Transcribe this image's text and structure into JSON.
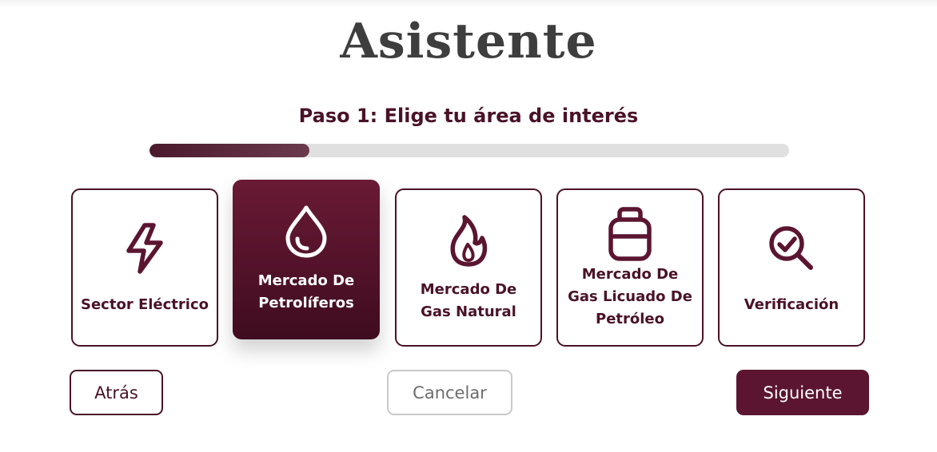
{
  "wizard": {
    "title": "Asistente",
    "step_label": "Paso 1: Elige tu área de interés",
    "progress": 0.25
  },
  "options": [
    {
      "label": "Sector Eléctrico",
      "icon": "lightning-bolt-icon",
      "selected": false
    },
    {
      "label": "Mercado De Petrolíferos",
      "icon": "oil-drop-icon",
      "selected": true
    },
    {
      "label": "Mercado De Gas Natural",
      "icon": "flame-icon",
      "selected": false
    },
    {
      "label": "Mercado De Gas Licuado De Petróleo",
      "icon": "gas-cylinder-icon",
      "selected": false
    },
    {
      "label": "Verificación",
      "icon": "magnifier-check-icon",
      "selected": false
    }
  ],
  "buttons": {
    "back": "Atrás",
    "cancel": "Cancelar",
    "next": "Siguiente"
  },
  "colors": {
    "accent": "#5b1531",
    "title": "#3e3e3e",
    "progress_track": "#e0e0e0"
  }
}
